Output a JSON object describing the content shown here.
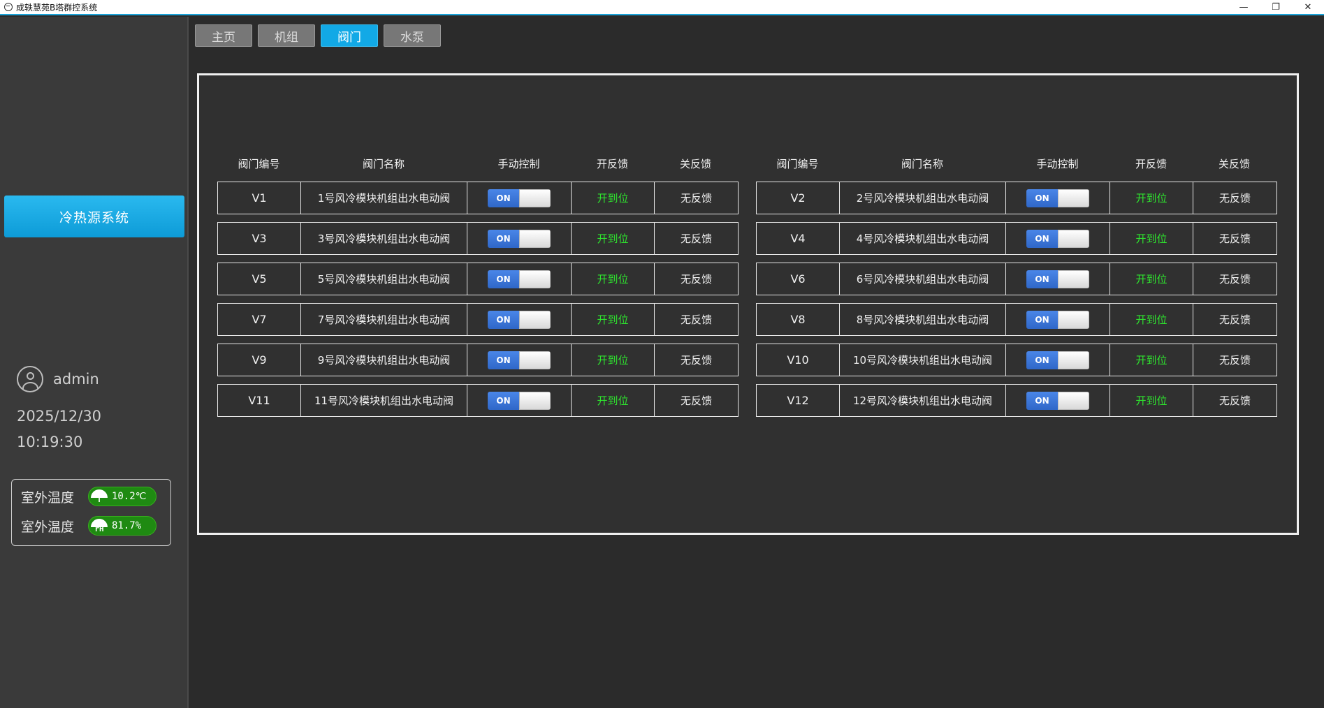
{
  "window": {
    "title": "成轶慧苑B塔群控系统",
    "min_glyph": "—",
    "restore_glyph": "❐",
    "close_glyph": "✕"
  },
  "sidebar": {
    "system_button": "冷热源系统",
    "user": "admin",
    "date": "2025/12/30",
    "time": "10:19:30",
    "weather": [
      {
        "label": "室外温度",
        "icon_text": "T",
        "value": "10.2℃",
        "icon": "thermometer-gauge-icon"
      },
      {
        "label": "室外温度",
        "icon_text": "rH",
        "value": "81.7%",
        "icon": "humidity-gauge-icon"
      }
    ]
  },
  "tabs": [
    "主页",
    "机组",
    "阀门",
    "水泵"
  ],
  "active_tab": "阀门",
  "table": {
    "headers": [
      "阀门编号",
      "阀门名称",
      "手动控制",
      "开反馈",
      "关反馈"
    ],
    "toggle_label": "ON",
    "left_rows": [
      {
        "code": "V1",
        "name": "1号风冷模块机组出水电动阀",
        "open": "开到位",
        "close": "无反馈"
      },
      {
        "code": "V3",
        "name": "3号风冷模块机组出水电动阀",
        "open": "开到位",
        "close": "无反馈"
      },
      {
        "code": "V5",
        "name": "5号风冷模块机组出水电动阀",
        "open": "开到位",
        "close": "无反馈"
      },
      {
        "code": "V7",
        "name": "7号风冷模块机组出水电动阀",
        "open": "开到位",
        "close": "无反馈"
      },
      {
        "code": "V9",
        "name": "9号风冷模块机组出水电动阀",
        "open": "开到位",
        "close": "无反馈"
      },
      {
        "code": "V11",
        "name": "11号风冷模块机组出水电动阀",
        "open": "开到位",
        "close": "无反馈"
      }
    ],
    "right_rows": [
      {
        "code": "V2",
        "name": "2号风冷模块机组出水电动阀",
        "open": "开到位",
        "close": "无反馈"
      },
      {
        "code": "V4",
        "name": "4号风冷模块机组出水电动阀",
        "open": "开到位",
        "close": "无反馈"
      },
      {
        "code": "V6",
        "name": "6号风冷模块机组出水电动阀",
        "open": "开到位",
        "close": "无反馈"
      },
      {
        "code": "V8",
        "name": "8号风冷模块机组出水电动阀",
        "open": "开到位",
        "close": "无反馈"
      },
      {
        "code": "V10",
        "name": "10号风冷模块机组出水电动阀",
        "open": "开到位",
        "close": "无反馈"
      },
      {
        "code": "V12",
        "name": "12号风冷模块机组出水电动阀",
        "open": "开到位",
        "close": "无反馈"
      }
    ]
  },
  "colors": {
    "accent": "#12a9e6",
    "feedback_open": "#2ee52e",
    "toggle_on": "#3a75d8",
    "background": "#303030"
  }
}
